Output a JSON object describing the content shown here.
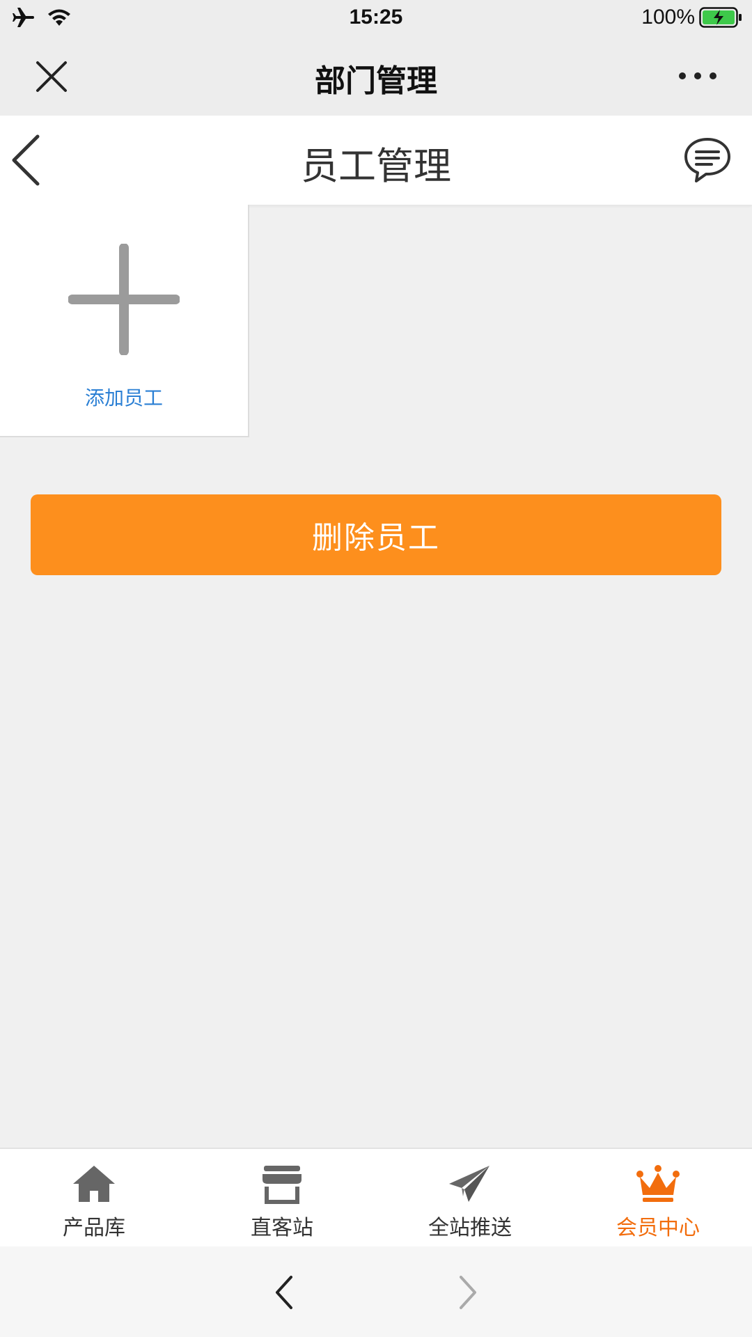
{
  "status_bar": {
    "time": "15:25",
    "battery": "100%"
  },
  "mini_program": {
    "title": "部门管理"
  },
  "header": {
    "title": "员工管理"
  },
  "add_card": {
    "label": "添加员工"
  },
  "actions": {
    "delete_label": "删除员工"
  },
  "tabbar": {
    "items": [
      {
        "label": "产品库",
        "icon": "home-icon"
      },
      {
        "label": "直客站",
        "icon": "store-icon"
      },
      {
        "label": "全站推送",
        "icon": "paper-plane-icon"
      },
      {
        "label": "会员中心",
        "icon": "crown-icon"
      }
    ],
    "active_index": 3
  },
  "colors": {
    "accent": "#fd8f1d",
    "active_tab": "#f26d0d",
    "link": "#2a7fd4"
  }
}
